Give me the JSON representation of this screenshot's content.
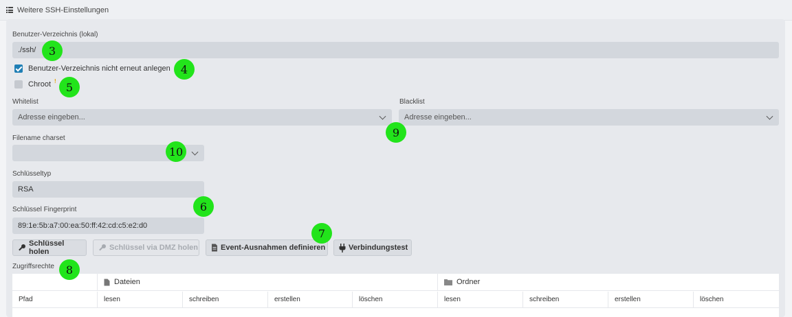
{
  "header": {
    "title": "Weitere SSH-Einstellungen",
    "icon": "list-icon"
  },
  "user_dir": {
    "label": "Benutzer-Verzeichnis (lokal)",
    "value": "./ssh/"
  },
  "checkboxes": {
    "no_recreate": {
      "label": "Benutzer-Verzeichnis nicht erneut anlegen",
      "checked": true
    },
    "chroot": {
      "label": "Chroot",
      "checked": false,
      "mark": "!"
    }
  },
  "whitelist": {
    "label": "Whitelist",
    "placeholder": "Adresse eingeben..."
  },
  "blacklist": {
    "label": "Blacklist",
    "placeholder": "Adresse eingeben..."
  },
  "filename_charset": {
    "label": "Filename charset",
    "value": ""
  },
  "key_type": {
    "label": "Schlüsseltyp",
    "value": "RSA"
  },
  "key_fingerprint": {
    "label": "Schlüssel Fingerprint",
    "value": "89:1e:5b:a7:00:ea:50:ff:42:cd:c5:e2:d0"
  },
  "buttons": {
    "get_key": "Schlüssel holen",
    "get_key_dmz": "Schlüssel via DMZ holen",
    "event_exceptions": "Event-Ausnahmen definieren",
    "connection_test": "Verbindungstest"
  },
  "access": {
    "label": "Zugriffsrechte",
    "groups": [
      "Dateien",
      "Ordner"
    ],
    "columns": [
      "Pfad",
      "lesen",
      "schreiben",
      "erstellen",
      "löschen",
      "lesen",
      "schreiben",
      "erstellen",
      "löschen"
    ]
  },
  "annotations": [
    "3",
    "4",
    "5",
    "9",
    "10",
    "6",
    "7",
    "8"
  ],
  "colors": {
    "accent": "#1f7fb5",
    "marker": "#22e41b",
    "warning": "#e8a200"
  }
}
